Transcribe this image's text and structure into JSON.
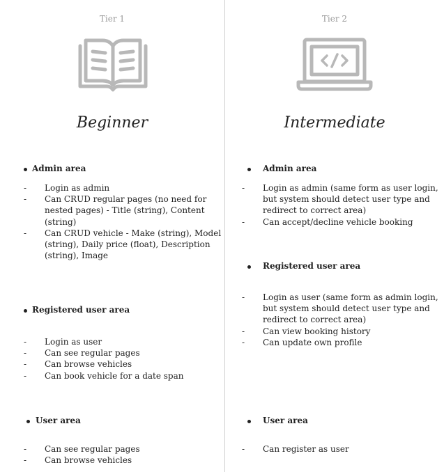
{
  "tiers": [
    {
      "tier_label": "Tier 1",
      "icon": "open-book-icon",
      "title": "Beginner",
      "sections": [
        {
          "title": "Admin area",
          "items": [
            "Login as admin",
            "Can CRUD regular pages (no need for nested pages) - Title (string), Content (string)",
            "Can CRUD vehicle - Make (string), Model (string), Daily price (float), Description (string), Image"
          ]
        },
        {
          "title": "Registered user area",
          "items": [
            "Login as user",
            "Can see regular pages",
            "Can browse vehicles",
            "Can book vehicle for a date span"
          ]
        },
        {
          "title": "User area",
          "items": [
            "Can see regular pages",
            "Can browse vehicles"
          ]
        }
      ]
    },
    {
      "tier_label": "Tier 2",
      "icon": "laptop-code-icon",
      "title": "Intermediate",
      "sections": [
        {
          "title": "Admin area",
          "items": [
            "Login as admin (same form as user login, but system should detect user type and redirect to correct area)",
            "Can accept/decline vehicle booking"
          ]
        },
        {
          "title": "Registered user area",
          "items": [
            "Login as user (same form as admin login, but system should detect user type and redirect to correct area)",
            "Can view booking history",
            "Can update own profile"
          ]
        },
        {
          "title": "User area",
          "items": [
            "Can register as user"
          ]
        }
      ]
    }
  ],
  "colors": {
    "icon_gray": "#b8b8b8",
    "muted_text": "#9a9a9a",
    "divider": "#cfcfcf"
  }
}
